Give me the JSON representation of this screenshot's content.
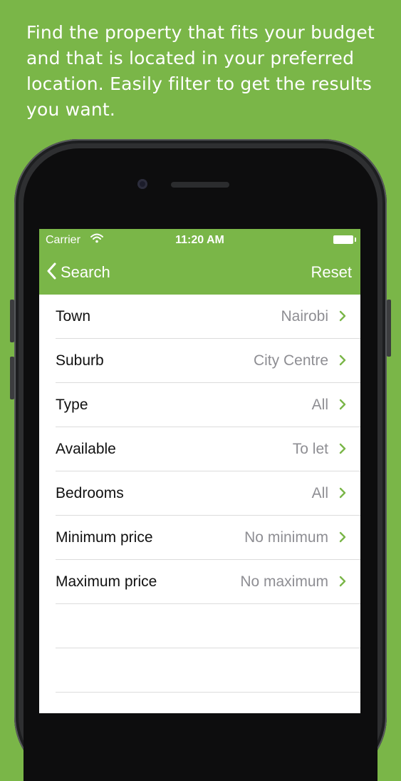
{
  "caption": "Find the property that fits your budget and that is located in your preferred location. Easily filter to get the results you want.",
  "status_bar": {
    "carrier": "Carrier",
    "time": "11:20 AM"
  },
  "nav": {
    "back_label": "Search",
    "reset_label": "Reset"
  },
  "filters": [
    {
      "label": "Town",
      "value": "Nairobi"
    },
    {
      "label": "Suburb",
      "value": "City Centre"
    },
    {
      "label": "Type",
      "value": "All"
    },
    {
      "label": "Available",
      "value": "To let"
    },
    {
      "label": "Bedrooms",
      "value": "All"
    },
    {
      "label": "Minimum price",
      "value": "No minimum"
    },
    {
      "label": "Maximum price",
      "value": "No maximum"
    }
  ],
  "colors": {
    "accent_green": "#7ab648",
    "value_gray": "#8e8e93",
    "separator": "#dcdcdc"
  },
  "icons": {
    "back": "chevron-left-icon",
    "disclosure": "chevron-right-icon",
    "wifi": "wifi-icon",
    "battery": "battery-icon"
  }
}
